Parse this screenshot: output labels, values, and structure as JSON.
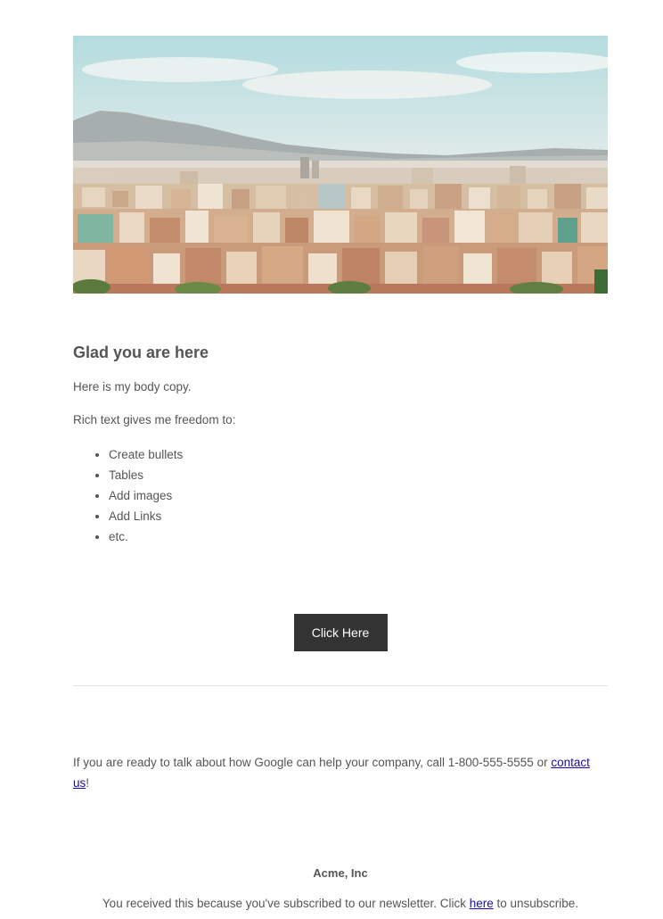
{
  "hero": {
    "alt": "Hillside city skyline with mountains under a pale blue sky"
  },
  "content": {
    "heading": "Glad you are here",
    "body_copy": "Here is my body copy.",
    "rich_text_intro": "Rich text gives me freedom to:",
    "bullets": [
      "Create bullets",
      "Tables",
      "Add images",
      "Add Links",
      "etc."
    ]
  },
  "cta": {
    "label": "Click Here"
  },
  "contact": {
    "text_before": "If you are ready to talk about how Google can help your company, call 1-800-555-5555 or ",
    "link_text": "contact us",
    "text_after": "!"
  },
  "footer": {
    "company": "Acme, Inc",
    "note_before": "You received this because you've subscribed to our newsletter. Click ",
    "link_text": "here",
    "note_after": " to unsubscribe."
  },
  "colors": {
    "text": "#555555",
    "button_bg": "#333333",
    "button_text": "#ffffff",
    "link": "#1a0dab",
    "divider": "#e3e3e3"
  }
}
